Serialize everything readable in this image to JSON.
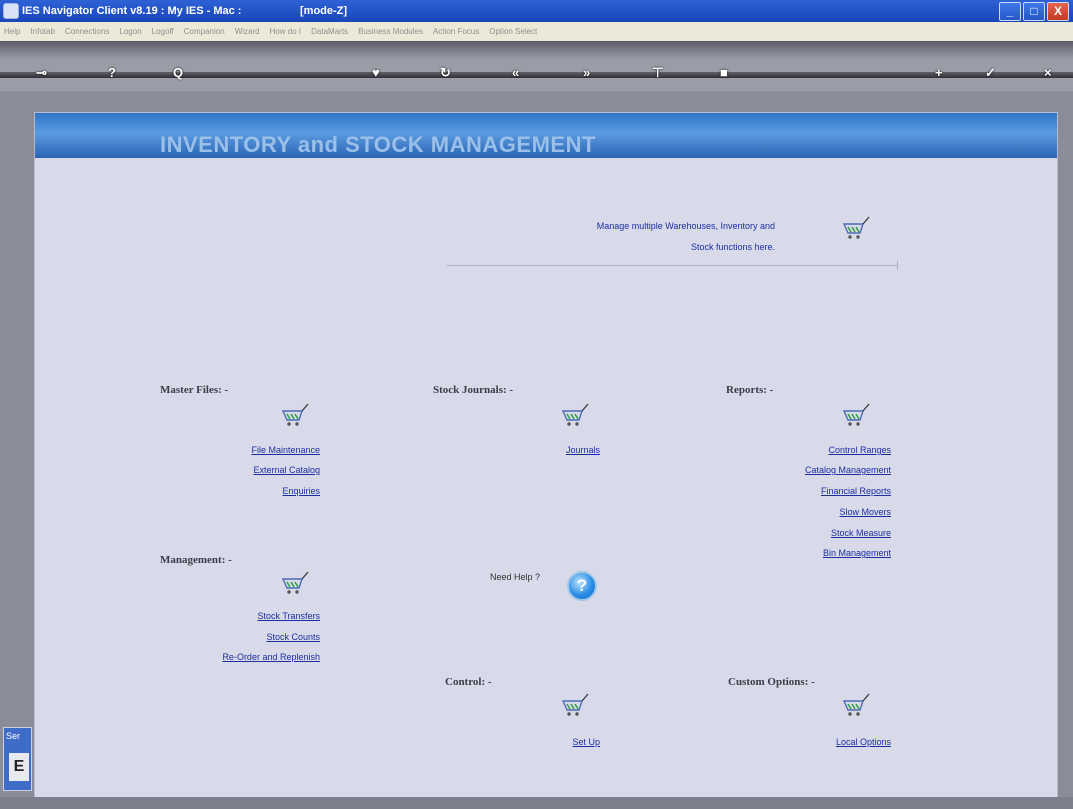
{
  "window": {
    "title": "IES Navigator Client v8.19 : My IES - Mac :",
    "mode": "[mode-Z]",
    "buttons": [
      "_",
      "□",
      "X"
    ]
  },
  "menu": {
    "items": [
      "Help",
      "Infotab",
      "Connections",
      "Logon",
      "Logoff",
      "Companion",
      "Wizard",
      "How do I",
      "DataMarts",
      "Business Modules",
      "Action Focus",
      "Option Select"
    ]
  },
  "toolbar": {
    "buttons": [
      {
        "icon": "key-icon",
        "glyph": "⊸"
      },
      {
        "icon": "help-icon",
        "glyph": "?"
      },
      {
        "icon": "search-icon",
        "glyph": "Q"
      },
      {
        "icon": "heart-icon",
        "glyph": "♥"
      },
      {
        "icon": "refresh-icon",
        "glyph": "↻"
      },
      {
        "icon": "back-icon",
        "glyph": "«"
      },
      {
        "icon": "forward-icon",
        "glyph": "»"
      },
      {
        "icon": "pin-icon",
        "glyph": "⊤"
      },
      {
        "icon": "stop-icon",
        "glyph": "■"
      },
      {
        "icon": "add-icon",
        "glyph": "+"
      },
      {
        "icon": "check-icon",
        "glyph": "✓"
      },
      {
        "icon": "close-icon",
        "glyph": "×"
      }
    ]
  },
  "banner": {
    "title": "INVENTORY and STOCK MANAGEMENT"
  },
  "intro": {
    "line1": "Manage multiple Warehouses, Inventory and",
    "line2": "Stock functions here."
  },
  "sections": {
    "master_files": {
      "heading": "Master Files: -",
      "links": [
        "File Maintenance",
        "External Catalog",
        "Enquiries"
      ]
    },
    "stock_journals": {
      "heading": "Stock Journals: -",
      "links": [
        "Journals"
      ]
    },
    "reports": {
      "heading": "Reports: -",
      "links": [
        "Control Ranges",
        "Catalog Management",
        "Financial Reports",
        "Slow Movers",
        "Stock Measure",
        "Bin Management"
      ]
    },
    "management": {
      "heading": "Management: -",
      "links": [
        "Stock Transfers",
        "Stock Counts",
        "Re-Order and Replenish"
      ]
    },
    "control": {
      "heading": "Control: -",
      "links": [
        "Set Up"
      ]
    },
    "custom_options": {
      "heading": "Custom Options: -",
      "links": [
        "Local Options"
      ]
    }
  },
  "help": {
    "label": "Need Help ?",
    "glyph": "?"
  },
  "side_tab": {
    "label": "Ser",
    "box": "E"
  },
  "colors": {
    "banner": "#2f76c7",
    "panel": "#d8dae9",
    "link": "#1c2fa0"
  }
}
